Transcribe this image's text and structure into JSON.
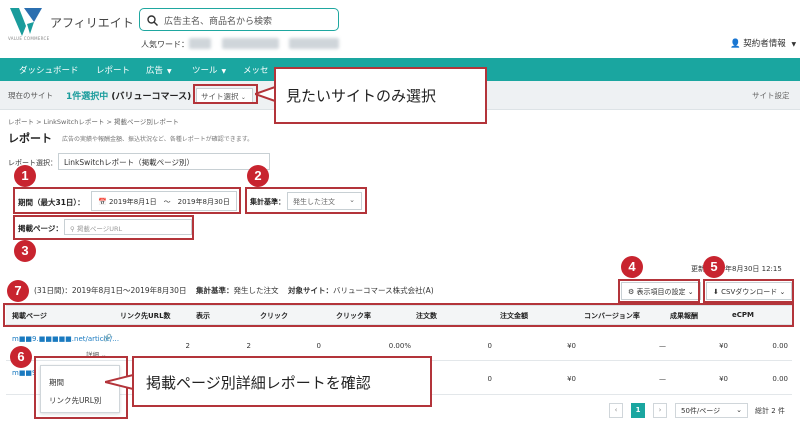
{
  "header": {
    "logo_text": "アフィリエイト",
    "logo_sub": "VALUE COMMERCE",
    "search_placeholder": "広告主名、商品名から検索",
    "popular_label": "人気ワード：",
    "account_label": "契約者情報"
  },
  "nav": [
    "ダッシュボード",
    "レポート",
    "広告",
    "ツール",
    "メッセ"
  ],
  "sitebar": {
    "current_label": "現在のサイト",
    "selected_count": "1件選択中",
    "selected_site": "(バリューコマース)",
    "site_select_label": "サイト選択",
    "settings": "サイト設定"
  },
  "breadcrumb": "レポート  >  LinkSwitchレポート  >  掲載ページ別レポート",
  "page": {
    "title": "レポート",
    "description": "広告の実績や報酬金額、振込状況など、各種レポートが確認できます。",
    "report_select_label": "レポート選択：",
    "report_select_value": "LinkSwitchレポート（掲載ページ別）"
  },
  "filters": {
    "period_label": "期間（最大31日）：",
    "period_value": "2019年8月1日　〜　2019年8月30日",
    "basis_label": "集計基準：",
    "basis_value": "発生した注文",
    "page_label": "掲載ページ：",
    "page_placeholder": "掲載ページURL"
  },
  "summary": {
    "updated": "更新",
    "updated_date": "2019年8月30日 12:15",
    "period_prefix": "(31日間)",
    "period": "：2019年8月1日〜2019年8月30日",
    "basis_label": "集計基準：",
    "basis": "発生した注文",
    "site_label": "対象サイト：",
    "site": "バリューコマース株式会社(A)",
    "columns_button": "表示項目の設定",
    "csv_button": "CSVダウンロード"
  },
  "table": {
    "headers": [
      "掲載ページ",
      "リンク先URL数",
      "表示",
      "クリック",
      "クリック率",
      "注文数",
      "注文金額",
      "コンバージョン率",
      "成果報酬",
      "eCPM"
    ],
    "rows": [
      {
        "page": "m■■9.■■■■■.net/article/…",
        "values": [
          "2",
          "2",
          "0",
          "0.00%",
          "0",
          "¥0",
          "—",
          "¥0",
          "0.00"
        ]
      },
      {
        "page": "m■■9",
        "values": [
          "",
          "",
          "",
          "",
          "0",
          "¥0",
          "—",
          "¥0",
          "0.00"
        ]
      }
    ],
    "detail_label": "詳細"
  },
  "dropdown": [
    "期間",
    "リンク先URL別"
  ],
  "pagination": {
    "prev": "‹",
    "current": "1",
    "next": "›",
    "per_page": "50件/ページ",
    "total": "総計 2 件"
  },
  "annotations": {
    "numbers": [
      "1",
      "2",
      "3",
      "4",
      "5",
      "6",
      "7"
    ],
    "callout_site": "見たいサイトのみ選択",
    "callout_detail": "掲載ページ別詳細レポートを確認"
  },
  "colors": {
    "teal": "#1aa6a0",
    "annotation_red": "#c8242f"
  }
}
